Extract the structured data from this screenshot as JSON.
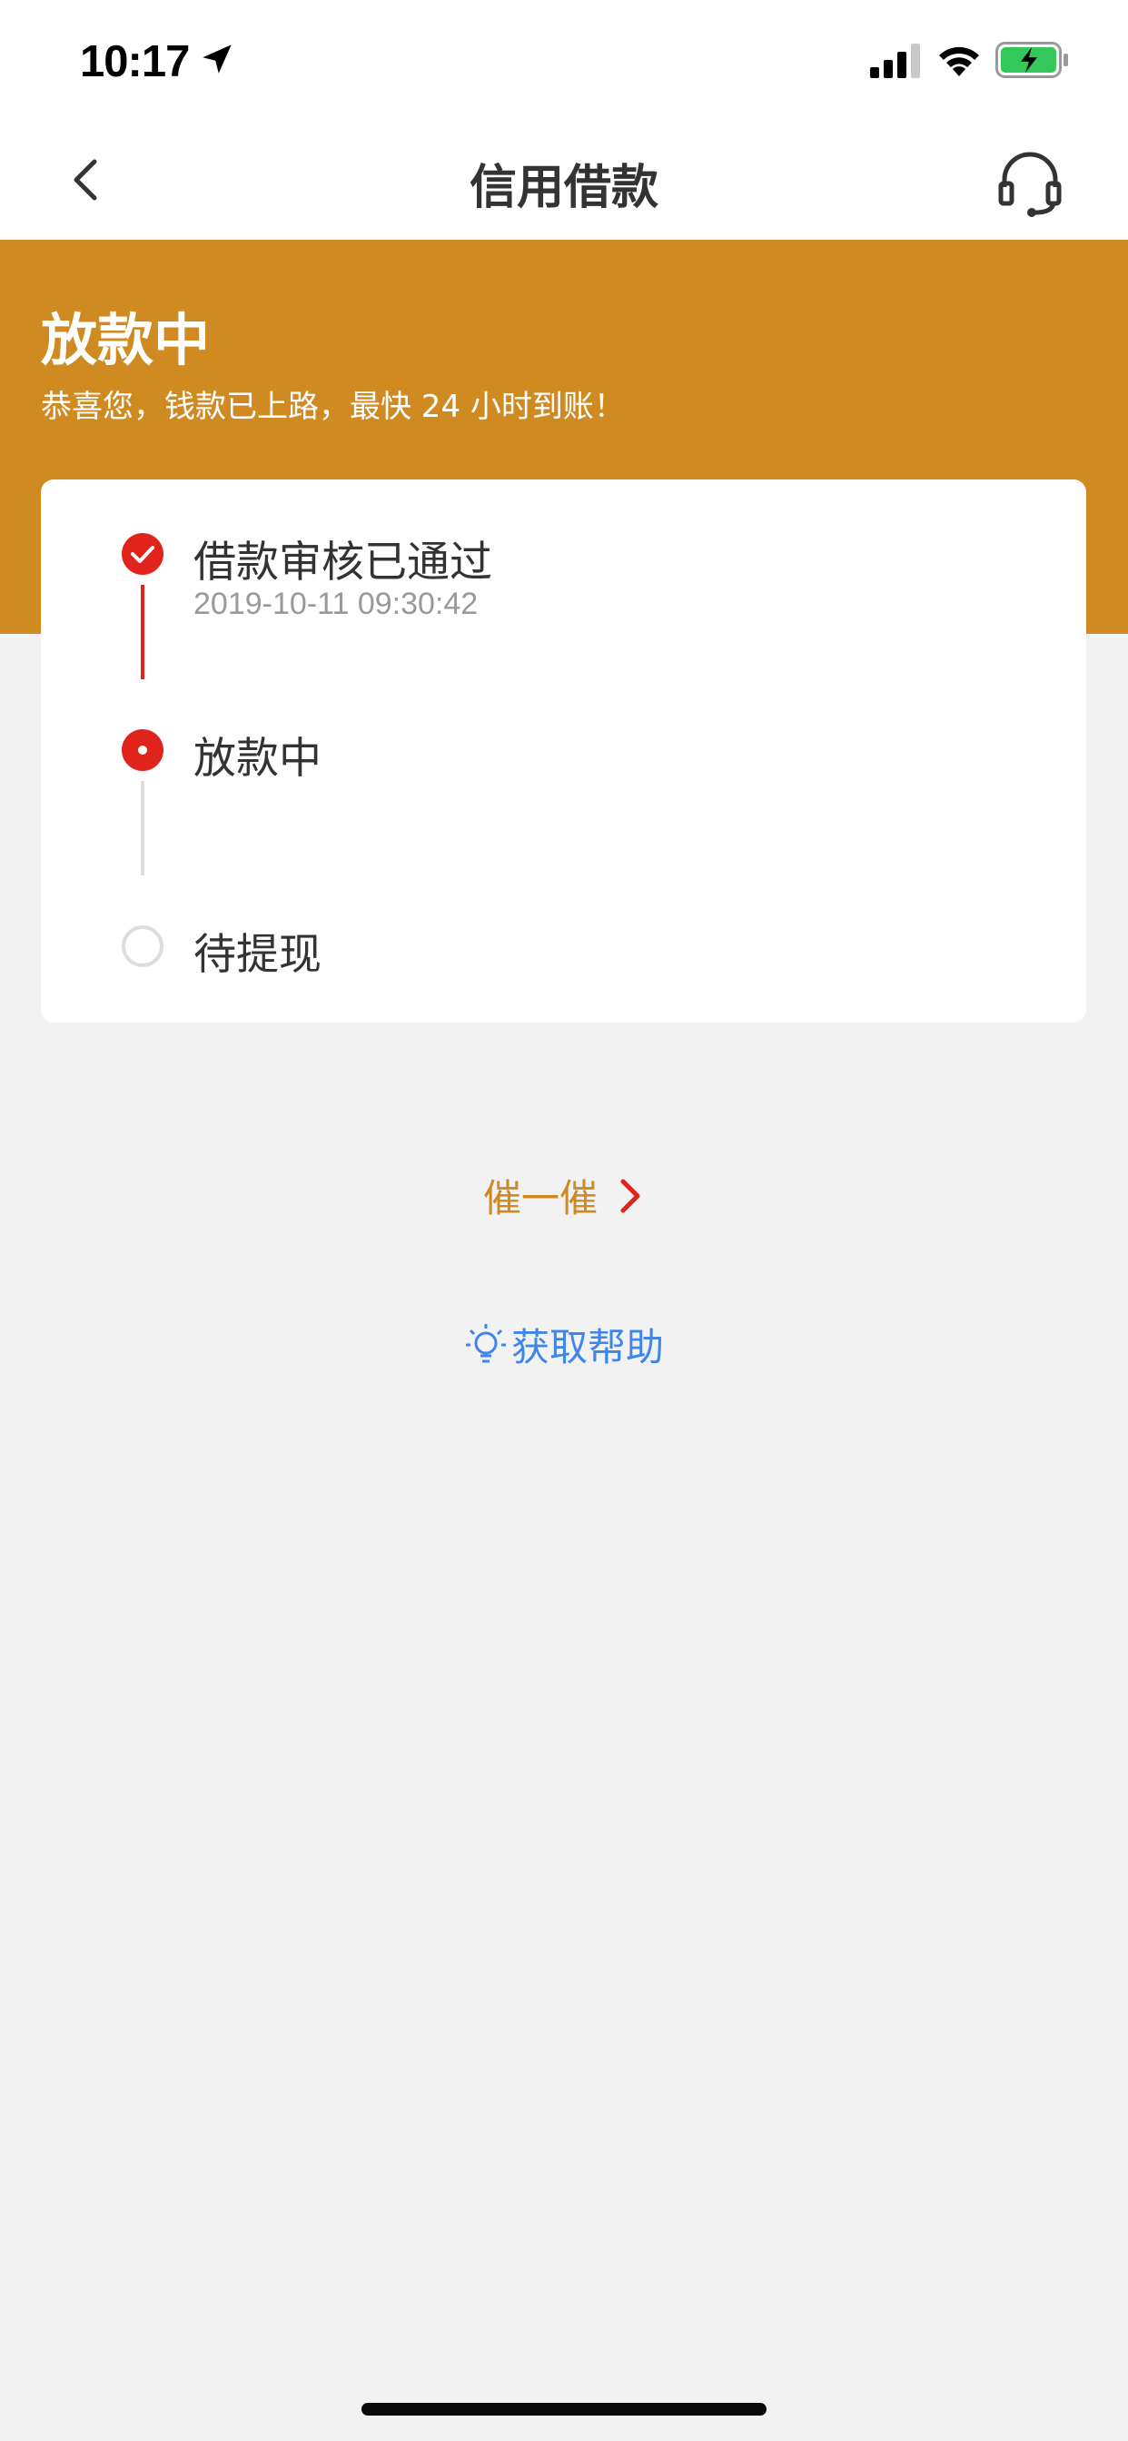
{
  "status_bar": {
    "time": "10:17"
  },
  "nav": {
    "title": "信用借款",
    "back_icon": "chevron-left-icon",
    "support_icon": "headset-icon"
  },
  "hero": {
    "title": "放款中",
    "subtitle": "恭喜您，钱款已上路，最快 24 小时到账！",
    "color": "#d08a22"
  },
  "progress": {
    "steps": [
      {
        "label": "借款审核已通过",
        "time": "2019-10-11 09:30:42",
        "state": "done"
      },
      {
        "label": "放款中",
        "state": "current"
      },
      {
        "label": "待提现",
        "state": "pending"
      }
    ],
    "accent": "#e0241c"
  },
  "actions": {
    "urge_label": "催一催",
    "help_label": "获取帮助",
    "help_color": "#3f86e8"
  }
}
